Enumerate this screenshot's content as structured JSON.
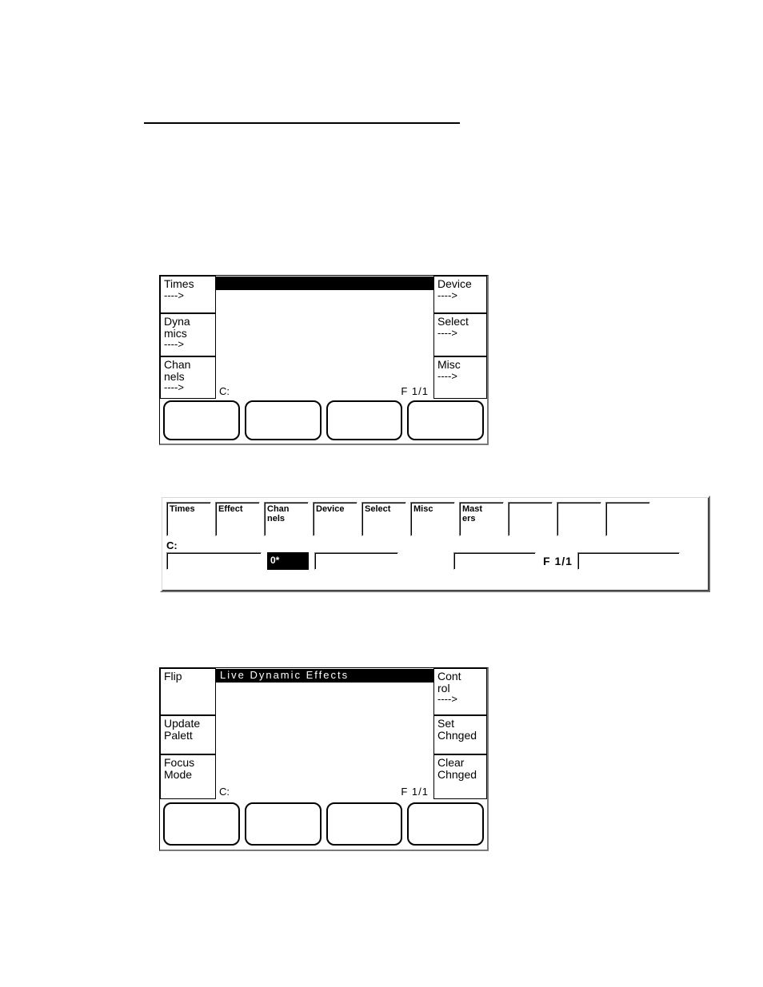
{
  "panel1": {
    "left": [
      {
        "label": "Times",
        "arrow": "---->"
      },
      {
        "label": "Dyna\nmics",
        "arrow": "---->"
      },
      {
        "label": "Chan\nnels",
        "arrow": "---->"
      }
    ],
    "right": [
      {
        "label": "Device",
        "arrow": "---->"
      },
      {
        "label": "Select",
        "arrow": "---->"
      },
      {
        "label": "Misc",
        "arrow": "---->"
      }
    ],
    "title": "",
    "c_label": "C:",
    "f_label": "F  1/1"
  },
  "panel2": {
    "top": [
      "Times",
      "Effect",
      "Chan\nnels",
      "Device",
      "Select",
      "Misc",
      "Mast\ners",
      "",
      "",
      ""
    ],
    "c_label": "C:",
    "dark_value": "0*",
    "f_label": "F 1/1"
  },
  "panel3": {
    "left": [
      {
        "label": "Flip"
      },
      {
        "label": "Update\nPalett"
      },
      {
        "label": "Focus\nMode"
      }
    ],
    "right": [
      {
        "label": "Cont\nrol",
        "arrow": "---->"
      },
      {
        "label": "Set\nChnged"
      },
      {
        "label": "Clear\nChnged"
      }
    ],
    "title": "Live  Dynamic  Effects",
    "c_label": "C:",
    "f_label": "F  1/1"
  }
}
